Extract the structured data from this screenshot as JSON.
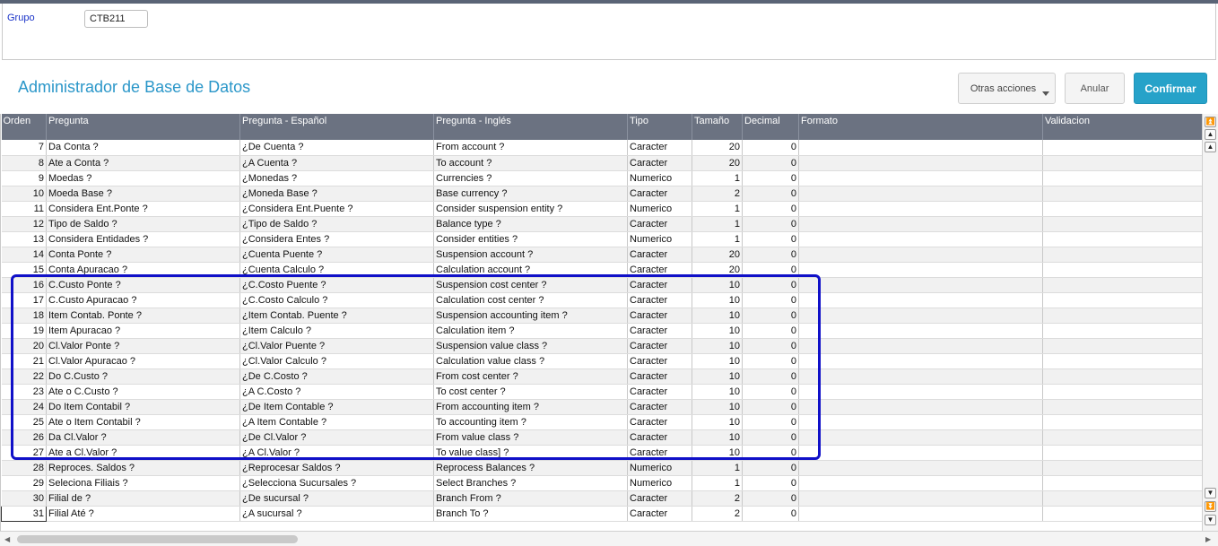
{
  "header": {
    "group_label": "Grupo",
    "group_value": "CTB211"
  },
  "page_title": "Administrador de Base de Datos",
  "actions": {
    "other_label": "Otras acciones",
    "cancel_label": "Anular",
    "confirm_label": "Confirmar"
  },
  "colors": {
    "accent": "#26a2c9",
    "header_bg": "#6b7281",
    "highlight": "#1010c8",
    "label_blue": "#1a33c8"
  },
  "grid": {
    "columns": [
      "Orden",
      "Pregunta",
      "Pregunta - Español",
      "Pregunta - Inglés",
      "Tipo",
      "Tamaño",
      "Decimal",
      "Formato",
      "Validacion"
    ],
    "rows": [
      {
        "orden": "7",
        "pregunta": "Da Conta ?",
        "pregunta_es": "¿De Cuenta ?",
        "pregunta_en": "From account ?",
        "tipo": "Caracter",
        "tamano": "20",
        "decimal": "0"
      },
      {
        "orden": "8",
        "pregunta": "Ate a Conta ?",
        "pregunta_es": "¿A Cuenta ?",
        "pregunta_en": "To account ?",
        "tipo": "Caracter",
        "tamano": "20",
        "decimal": "0"
      },
      {
        "orden": "9",
        "pregunta": "Moedas ?",
        "pregunta_es": "¿Monedas ?",
        "pregunta_en": "Currencies ?",
        "tipo": "Numerico",
        "tamano": "1",
        "decimal": "0"
      },
      {
        "orden": "10",
        "pregunta": "Moeda Base ?",
        "pregunta_es": "¿Moneda Base ?",
        "pregunta_en": "Base currency ?",
        "tipo": "Caracter",
        "tamano": "2",
        "decimal": "0"
      },
      {
        "orden": "11",
        "pregunta": "Considera Ent.Ponte ?",
        "pregunta_es": "¿Considera Ent.Puente ?",
        "pregunta_en": "Consider suspension entity ?",
        "tipo": "Numerico",
        "tamano": "1",
        "decimal": "0"
      },
      {
        "orden": "12",
        "pregunta": "Tipo de Saldo ?",
        "pregunta_es": "¿Tipo de Saldo ?",
        "pregunta_en": "Balance type ?",
        "tipo": "Caracter",
        "tamano": "1",
        "decimal": "0"
      },
      {
        "orden": "13",
        "pregunta": "Considera Entidades ?",
        "pregunta_es": "¿Considera Entes ?",
        "pregunta_en": "Consider entities ?",
        "tipo": "Numerico",
        "tamano": "1",
        "decimal": "0"
      },
      {
        "orden": "14",
        "pregunta": "Conta Ponte ?",
        "pregunta_es": "¿Cuenta Puente ?",
        "pregunta_en": "Suspension account ?",
        "tipo": "Caracter",
        "tamano": "20",
        "decimal": "0"
      },
      {
        "orden": "15",
        "pregunta": "Conta Apuracao ?",
        "pregunta_es": "¿Cuenta Calculo ?",
        "pregunta_en": "Calculation account ?",
        "tipo": "Caracter",
        "tamano": "20",
        "decimal": "0"
      },
      {
        "orden": "16",
        "pregunta": "C.Custo Ponte ?",
        "pregunta_es": "¿C.Costo Puente ?",
        "pregunta_en": "Suspension cost center ?",
        "tipo": "Caracter",
        "tamano": "10",
        "decimal": "0"
      },
      {
        "orden": "17",
        "pregunta": "C.Custo Apuracao ?",
        "pregunta_es": "¿C.Costo Calculo ?",
        "pregunta_en": "Calculation cost center ?",
        "tipo": "Caracter",
        "tamano": "10",
        "decimal": "0"
      },
      {
        "orden": "18",
        "pregunta": "Item Contab. Ponte ?",
        "pregunta_es": "¿Item Contab. Puente ?",
        "pregunta_en": "Suspension accounting item ?",
        "tipo": "Caracter",
        "tamano": "10",
        "decimal": "0"
      },
      {
        "orden": "19",
        "pregunta": "Item Apuracao  ?",
        "pregunta_es": "¿Item Calculo  ?",
        "pregunta_en": "Calculation item ?",
        "tipo": "Caracter",
        "tamano": "10",
        "decimal": "0"
      },
      {
        "orden": "20",
        "pregunta": "Cl.Valor Ponte ?",
        "pregunta_es": "¿Cl.Valor Puente ?",
        "pregunta_en": "Suspension value class ?",
        "tipo": "Caracter",
        "tamano": "10",
        "decimal": "0"
      },
      {
        "orden": "21",
        "pregunta": "Cl.Valor Apuracao ?",
        "pregunta_es": "¿Cl.Valor Calculo ?",
        "pregunta_en": "Calculation value class ?",
        "tipo": "Caracter",
        "tamano": "10",
        "decimal": "0"
      },
      {
        "orden": "22",
        "pregunta": "Do C.Custo ?",
        "pregunta_es": "¿De C.Costo ?",
        "pregunta_en": "From cost center ?",
        "tipo": "Caracter",
        "tamano": "10",
        "decimal": "0"
      },
      {
        "orden": "23",
        "pregunta": "Ate o C.Custo ?",
        "pregunta_es": "¿A C.Costo ?",
        "pregunta_en": "To cost center ?",
        "tipo": "Caracter",
        "tamano": "10",
        "decimal": "0"
      },
      {
        "orden": "24",
        "pregunta": "Do Item Contabil ?",
        "pregunta_es": "¿De Item Contable ?",
        "pregunta_en": "From accounting item ?",
        "tipo": "Caracter",
        "tamano": "10",
        "decimal": "0"
      },
      {
        "orden": "25",
        "pregunta": "Ate o Item Contabil ?",
        "pregunta_es": "¿A Item Contable ?",
        "pregunta_en": "To accounting item ?",
        "tipo": "Caracter",
        "tamano": "10",
        "decimal": "0"
      },
      {
        "orden": "26",
        "pregunta": "Da Cl.Valor ?",
        "pregunta_es": "¿De Cl.Valor ?",
        "pregunta_en": "From value class ?",
        "tipo": "Caracter",
        "tamano": "10",
        "decimal": "0"
      },
      {
        "orden": "27",
        "pregunta": "Ate a Cl.Valor ?",
        "pregunta_es": "¿A Cl.Valor ?",
        "pregunta_en": "To value class] ?",
        "tipo": "Caracter",
        "tamano": "10",
        "decimal": "0"
      },
      {
        "orden": "28",
        "pregunta": "Reproces. Saldos ?",
        "pregunta_es": "¿Reprocesar Saldos ?",
        "pregunta_en": "Reprocess Balances ?",
        "tipo": "Numerico",
        "tamano": "1",
        "decimal": "0"
      },
      {
        "orden": "29",
        "pregunta": "Seleciona Filiais ?",
        "pregunta_es": "¿Selecciona Sucursales ?",
        "pregunta_en": "Select Branches ?",
        "tipo": "Numerico",
        "tamano": "1",
        "decimal": "0"
      },
      {
        "orden": "30",
        "pregunta": "Filial de ?",
        "pregunta_es": "¿De sucursal ?",
        "pregunta_en": "Branch From ?",
        "tipo": "Caracter",
        "tamano": "2",
        "decimal": "0"
      },
      {
        "orden": "31",
        "pregunta": "Filial Até ?",
        "pregunta_es": "¿A sucursal ?",
        "pregunta_en": "Branch To ?",
        "tipo": "Caracter",
        "tamano": "2",
        "decimal": "0"
      }
    ]
  },
  "icons": {
    "scroll_top": "double-up-arrow-icon",
    "scroll_up": "up-arrow-icon",
    "scroll_down": "down-arrow-icon",
    "scroll_bottom": "double-down-arrow-icon",
    "dropdown": "caret-down-icon"
  }
}
